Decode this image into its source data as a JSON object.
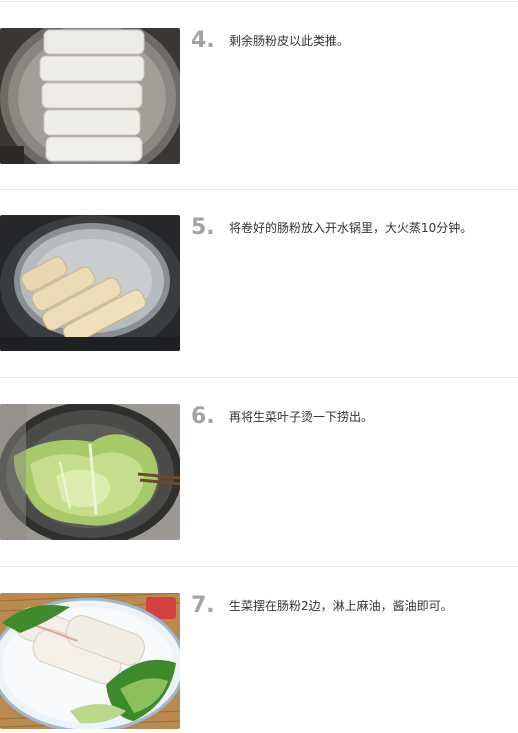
{
  "steps": [
    {
      "number": "4.",
      "text": "剩余肠粉皮以此类推。",
      "photo": "rolled-rice-noodles-on-steaming-plate"
    },
    {
      "number": "5.",
      "text": "将卷好的肠粉放入开水锅里，大火蒸10分钟。",
      "photo": "rice-rolls-in-steamer-pot"
    },
    {
      "number": "6.",
      "text": "再将生菜叶子烫一下捞出。",
      "photo": "lettuce-blanching-in-wok"
    },
    {
      "number": "7.",
      "text": "生菜摆在肠粉2边，淋上麻油，酱油即可。",
      "photo": "finished-rice-rolls-with-lettuce"
    }
  ]
}
